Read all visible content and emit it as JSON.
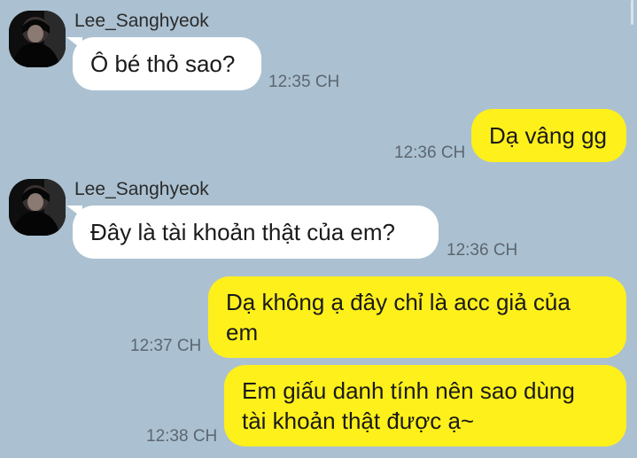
{
  "messages": [
    {
      "direction": "in",
      "sender": "Lee_Sanghyeok",
      "text": "Ô bé thỏ sao?",
      "time": "12:35 CH"
    },
    {
      "direction": "out",
      "text": "Dạ vâng  gg",
      "time": "12:36 CH"
    },
    {
      "direction": "in",
      "sender": "Lee_Sanghyeok",
      "text": "Đây là tài khoản thật của em?",
      "time": "12:36 CH"
    },
    {
      "direction": "out",
      "lines": [
        "Dạ không ạ đây chỉ là acc giả của",
        "em"
      ],
      "time": "12:37 CH"
    },
    {
      "direction": "out",
      "lines": [
        "Em giấu danh tính nên sao dùng",
        "tài khoản thật được ạ~"
      ],
      "time": "12:38 CH"
    }
  ],
  "colors": {
    "background": "#abc1d1",
    "incoming_bubble": "#ffffff",
    "outgoing_bubble": "#fef01b",
    "timestamp": "#5c6670"
  },
  "icons": [
    "avatar-photo",
    "scrollbar-thumb"
  ]
}
